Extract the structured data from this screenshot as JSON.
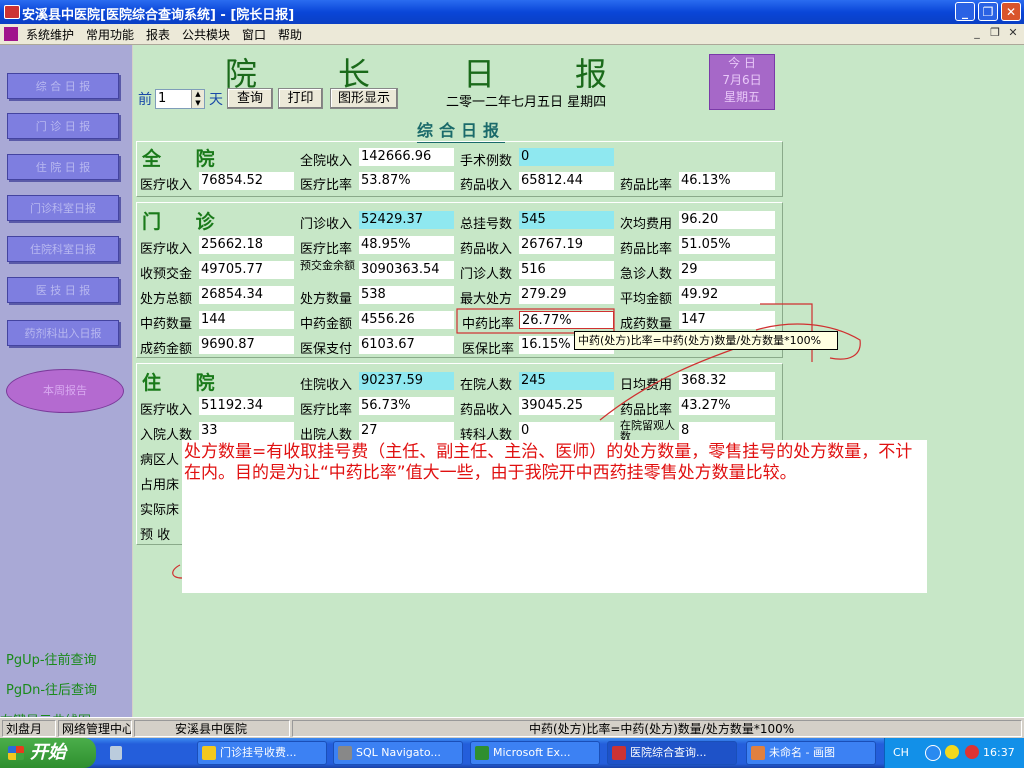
{
  "window": {
    "title": "安溪县中医院[医院综合查询系统] - [院长日报]"
  },
  "menu": [
    "系统维护",
    "常用功能",
    "报表",
    "公共模块",
    "窗口",
    "帮助"
  ],
  "sidebar": {
    "buttons": [
      "综 合 日 报",
      "门 诊 日 报",
      "住 院 日 报",
      "门诊科室日报",
      "住院科室日报",
      "医 技 日 报",
      "药剂科出入日报"
    ],
    "oval": "本周报告",
    "pgup": "PgUp-往前查询",
    "pgdn": "PgDn-往后查询",
    "right_hint": "右键显示曲线图"
  },
  "header": {
    "title_chars": [
      "院",
      "长",
      "日",
      "报"
    ],
    "prefix": "前",
    "days_value": "1",
    "suffix": "天",
    "query_label": "查询",
    "print_label": "打印",
    "graph_label": "图形显示",
    "date_text": "二零一二年七月五日  星期四",
    "today_box": [
      "今 日",
      "7月6日",
      "星期五"
    ],
    "section_title": "综合日报"
  },
  "whole": {
    "title": "全 院",
    "fields": [
      {
        "label": "全院收入",
        "value": "142666.96"
      },
      {
        "label": "手术例数",
        "value": "0"
      },
      {
        "label": "医疗收入",
        "value": "76854.52"
      },
      {
        "label": "医疗比率",
        "value": "53.87%"
      },
      {
        "label": "药品收入",
        "value": "65812.44"
      },
      {
        "label": "药品比率",
        "value": "46.13%"
      }
    ]
  },
  "outpatient": {
    "title": "门 诊",
    "fields": [
      {
        "label": "门诊收入",
        "value": "52429.37"
      },
      {
        "label": "总挂号数",
        "value": "545"
      },
      {
        "label": "次均费用",
        "value": "96.20"
      },
      {
        "label": "医疗收入",
        "value": "25662.18"
      },
      {
        "label": "医疗比率",
        "value": "48.95%"
      },
      {
        "label": "药品收入",
        "value": "26767.19"
      },
      {
        "label": "药品比率",
        "value": "51.05%"
      },
      {
        "label": "收预交金",
        "value": "49705.77"
      },
      {
        "label": "预交金余额",
        "value": "3090363.54"
      },
      {
        "label": "门诊人数",
        "value": "516"
      },
      {
        "label": "急诊人数",
        "value": "29"
      },
      {
        "label": "处方总额",
        "value": "26854.34"
      },
      {
        "label": "处方数量",
        "value": "538"
      },
      {
        "label": "最大处方",
        "value": "279.29"
      },
      {
        "label": "平均金额",
        "value": "49.92"
      },
      {
        "label": "中药数量",
        "value": "144"
      },
      {
        "label": "中药金额",
        "value": "4556.26"
      },
      {
        "label": "中药比率",
        "value": "26.77%"
      },
      {
        "label": "成药数量",
        "value": "147"
      },
      {
        "label": "成药金额",
        "value": "9690.87"
      },
      {
        "label": "医保支付",
        "value": "6103.67"
      },
      {
        "label": "医保比率",
        "value": "16.15%"
      }
    ]
  },
  "inpatient": {
    "title": "住 院",
    "fields": [
      {
        "label": "住院收入",
        "value": "90237.59"
      },
      {
        "label": "在院人数",
        "value": "245"
      },
      {
        "label": "日均费用",
        "value": "368.32"
      },
      {
        "label": "医疗收入",
        "value": "51192.34"
      },
      {
        "label": "医疗比率",
        "value": "56.73%"
      },
      {
        "label": "药品收入",
        "value": "39045.25"
      },
      {
        "label": "药品比率",
        "value": "43.27%"
      },
      {
        "label": "入院人数",
        "value": "33"
      },
      {
        "label": "出院人数",
        "value": "27"
      },
      {
        "label": "转科人数",
        "value": "0"
      },
      {
        "label": "在院留观人数",
        "value": "8"
      }
    ],
    "partial_labels": [
      "病区人",
      "占用床",
      "实际床",
      "预 收"
    ]
  },
  "tooltip": "中药(处方)比率=中药(处方)数量/处方数量*100%",
  "note": "处方数量=有收取挂号费（主任、副主任、主治、医师）的处方数量，零售挂号的处方数量，不计在内。目的是为让“中药比率”值大一些，由于我院开中西药挂零售处方数量比较。",
  "statusbar": [
    "刘盘月",
    "网络管理中心",
    "安溪县中医院",
    "中药(处方)比率=中药(处方)数量/处方数量*100%"
  ],
  "taskbar": {
    "start": "开始",
    "tasks": [
      "门诊挂号收费...",
      "SQL Navigato...",
      "Microsoft Ex...",
      "医院综合查询...",
      "未命名 - 画图"
    ],
    "tray_lang": "CH",
    "clock": "16:37"
  },
  "colors": {
    "title_green": "#1a6a1a",
    "cyan_field": "#8fe8f0",
    "note_red": "#e01010",
    "sidebar": "#a9a9d6"
  }
}
